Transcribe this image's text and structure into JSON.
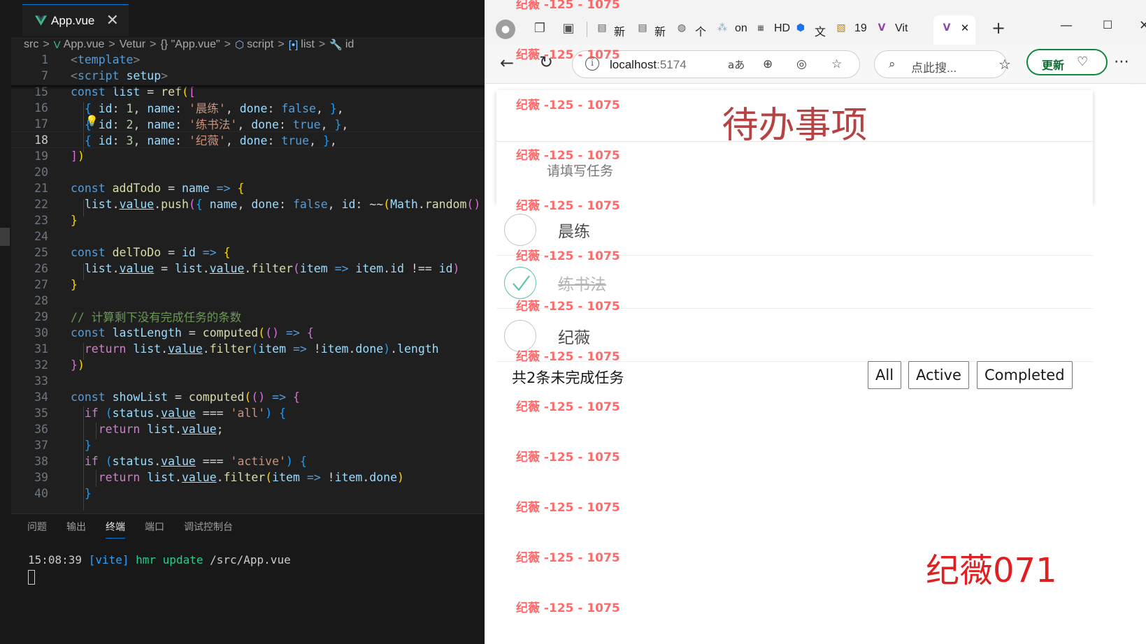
{
  "editor": {
    "tab_title": "App.vue",
    "breadcrumb": [
      "src",
      "App.vue",
      "Vetur",
      "{} \"App.vue\"",
      "script",
      "list",
      "id"
    ],
    "panel_tabs": [
      "问题",
      "输出",
      "终端",
      "端口",
      "调试控制台"
    ],
    "active_panel_tab": "终端",
    "terminal": {
      "time": "15:08:39",
      "tag": "[vite]",
      "event": "hmr update",
      "path": "/src/App.vue"
    },
    "line_numbers": [
      "1",
      "7",
      "15",
      "16",
      "17",
      "18",
      "19",
      "20",
      "21",
      "22",
      "23",
      "24",
      "25",
      "26",
      "27",
      "28",
      "29",
      "30",
      "31",
      "32",
      "33",
      "34",
      "35",
      "36",
      "37",
      "38",
      "39",
      "40"
    ],
    "current_line": "18"
  },
  "browser": {
    "tabs": [
      "新",
      "新",
      "个",
      "on",
      "HD",
      "文",
      "19",
      "Vit"
    ],
    "address": {
      "host": "localhost",
      "port": ":5174"
    },
    "search_placeholder": "点此搜...",
    "update_label": "更新"
  },
  "app": {
    "title": "待办事项",
    "input_placeholder": "请填写任务",
    "todos": [
      {
        "name": "晨练",
        "done": false
      },
      {
        "name": "练书法",
        "done": true
      },
      {
        "name": "纪薇",
        "done": false
      }
    ],
    "remaining_text": "共2条未完成任务",
    "filters": [
      "All",
      "Active",
      "Completed"
    ]
  },
  "watermark_text": "纪薇 -125 - 1075",
  "signature_text": "纪薇071",
  "colors": {
    "title_red": "#af2f2f",
    "check_green": "#5dc2af",
    "watermark": "#ff4a4a",
    "update_green": "#0b8a3e"
  }
}
